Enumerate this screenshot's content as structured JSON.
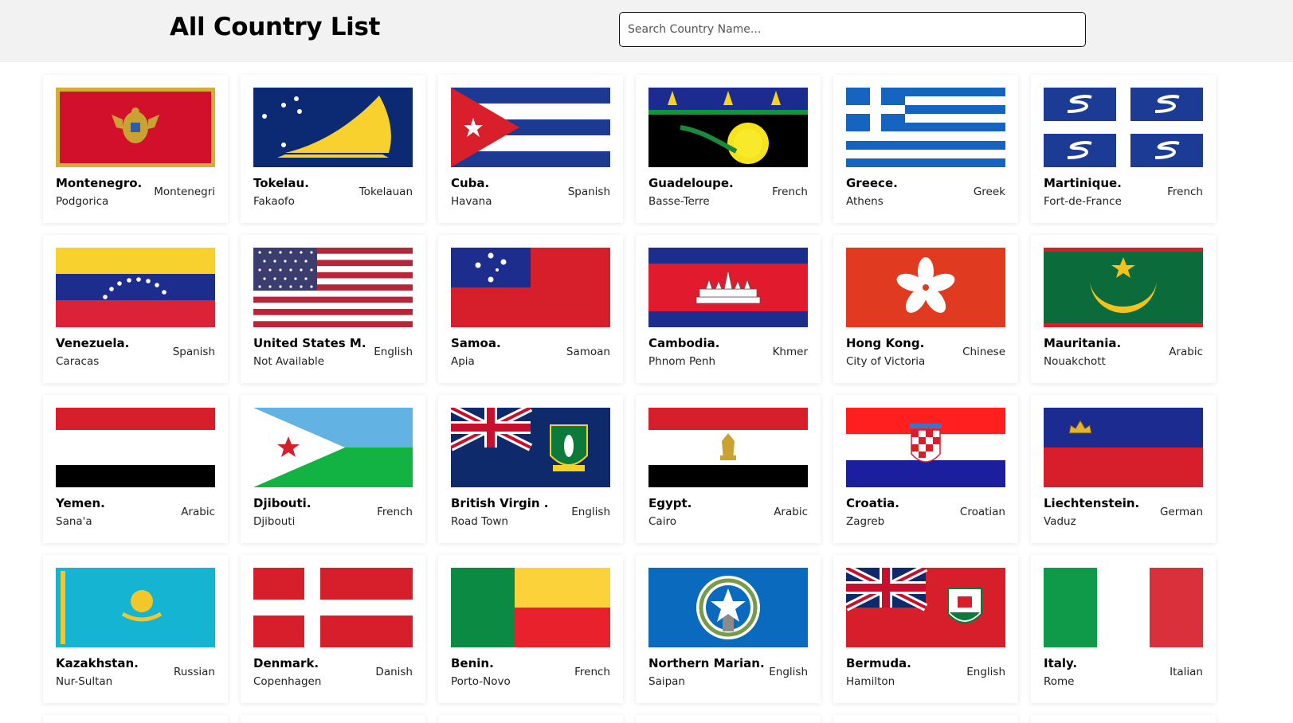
{
  "header": {
    "title": "All Country List",
    "search_placeholder": "Search Country Name..."
  },
  "countries": [
    {
      "name": "Montenegro.",
      "capital": "Podgorica",
      "language": "Montenegri",
      "flag_icon": "montenegro-flag"
    },
    {
      "name": "Tokelau.",
      "capital": "Fakaofo",
      "language": "Tokelauan",
      "flag_icon": "tokelau-flag"
    },
    {
      "name": "Cuba.",
      "capital": "Havana",
      "language": "Spanish",
      "flag_icon": "cuba-flag"
    },
    {
      "name": "Guadeloupe.",
      "capital": "Basse-Terre",
      "language": "French",
      "flag_icon": "guadeloupe-flag"
    },
    {
      "name": "Greece.",
      "capital": "Athens",
      "language": "Greek",
      "flag_icon": "greece-flag"
    },
    {
      "name": "Martinique.",
      "capital": "Fort-de-France",
      "language": "French",
      "flag_icon": "martinique-flag"
    },
    {
      "name": "Venezuela.",
      "capital": "Caracas",
      "language": "Spanish",
      "flag_icon": "venezuela-flag"
    },
    {
      "name": "United States M.",
      "capital": "Not Available",
      "language": "English",
      "flag_icon": "us-flag"
    },
    {
      "name": "Samoa.",
      "capital": "Apia",
      "language": "Samoan",
      "flag_icon": "samoa-flag"
    },
    {
      "name": "Cambodia.",
      "capital": "Phnom Penh",
      "language": "Khmer",
      "flag_icon": "cambodia-flag"
    },
    {
      "name": "Hong Kong.",
      "capital": "City of Victoria",
      "language": "Chinese",
      "flag_icon": "hong-kong-flag"
    },
    {
      "name": "Mauritania.",
      "capital": "Nouakchott",
      "language": "Arabic",
      "flag_icon": "mauritania-flag"
    },
    {
      "name": "Yemen.",
      "capital": "Sana'a",
      "language": "Arabic",
      "flag_icon": "yemen-flag"
    },
    {
      "name": "Djibouti.",
      "capital": "Djibouti",
      "language": "French",
      "flag_icon": "djibouti-flag"
    },
    {
      "name": "British Virgin .",
      "capital": "Road Town",
      "language": "English",
      "flag_icon": "british-virgin-islands-flag"
    },
    {
      "name": "Egypt.",
      "capital": "Cairo",
      "language": "Arabic",
      "flag_icon": "egypt-flag"
    },
    {
      "name": "Croatia.",
      "capital": "Zagreb",
      "language": "Croatian",
      "flag_icon": "croatia-flag"
    },
    {
      "name": "Liechtenstein.",
      "capital": "Vaduz",
      "language": "German",
      "flag_icon": "liechtenstein-flag"
    },
    {
      "name": "Kazakhstan.",
      "capital": "Nur-Sultan",
      "language": "Russian",
      "flag_icon": "kazakhstan-flag"
    },
    {
      "name": "Denmark.",
      "capital": "Copenhagen",
      "language": "Danish",
      "flag_icon": "denmark-flag"
    },
    {
      "name": "Benin.",
      "capital": "Porto-Novo",
      "language": "French",
      "flag_icon": "benin-flag"
    },
    {
      "name": "Northern Marian.",
      "capital": "Saipan",
      "language": "English",
      "flag_icon": "northern-mariana-islands-flag"
    },
    {
      "name": "Bermuda.",
      "capital": "Hamilton",
      "language": "English",
      "flag_icon": "bermuda-flag"
    },
    {
      "name": "Italy.",
      "capital": "Rome",
      "language": "Italian",
      "flag_icon": "italy-flag"
    }
  ]
}
